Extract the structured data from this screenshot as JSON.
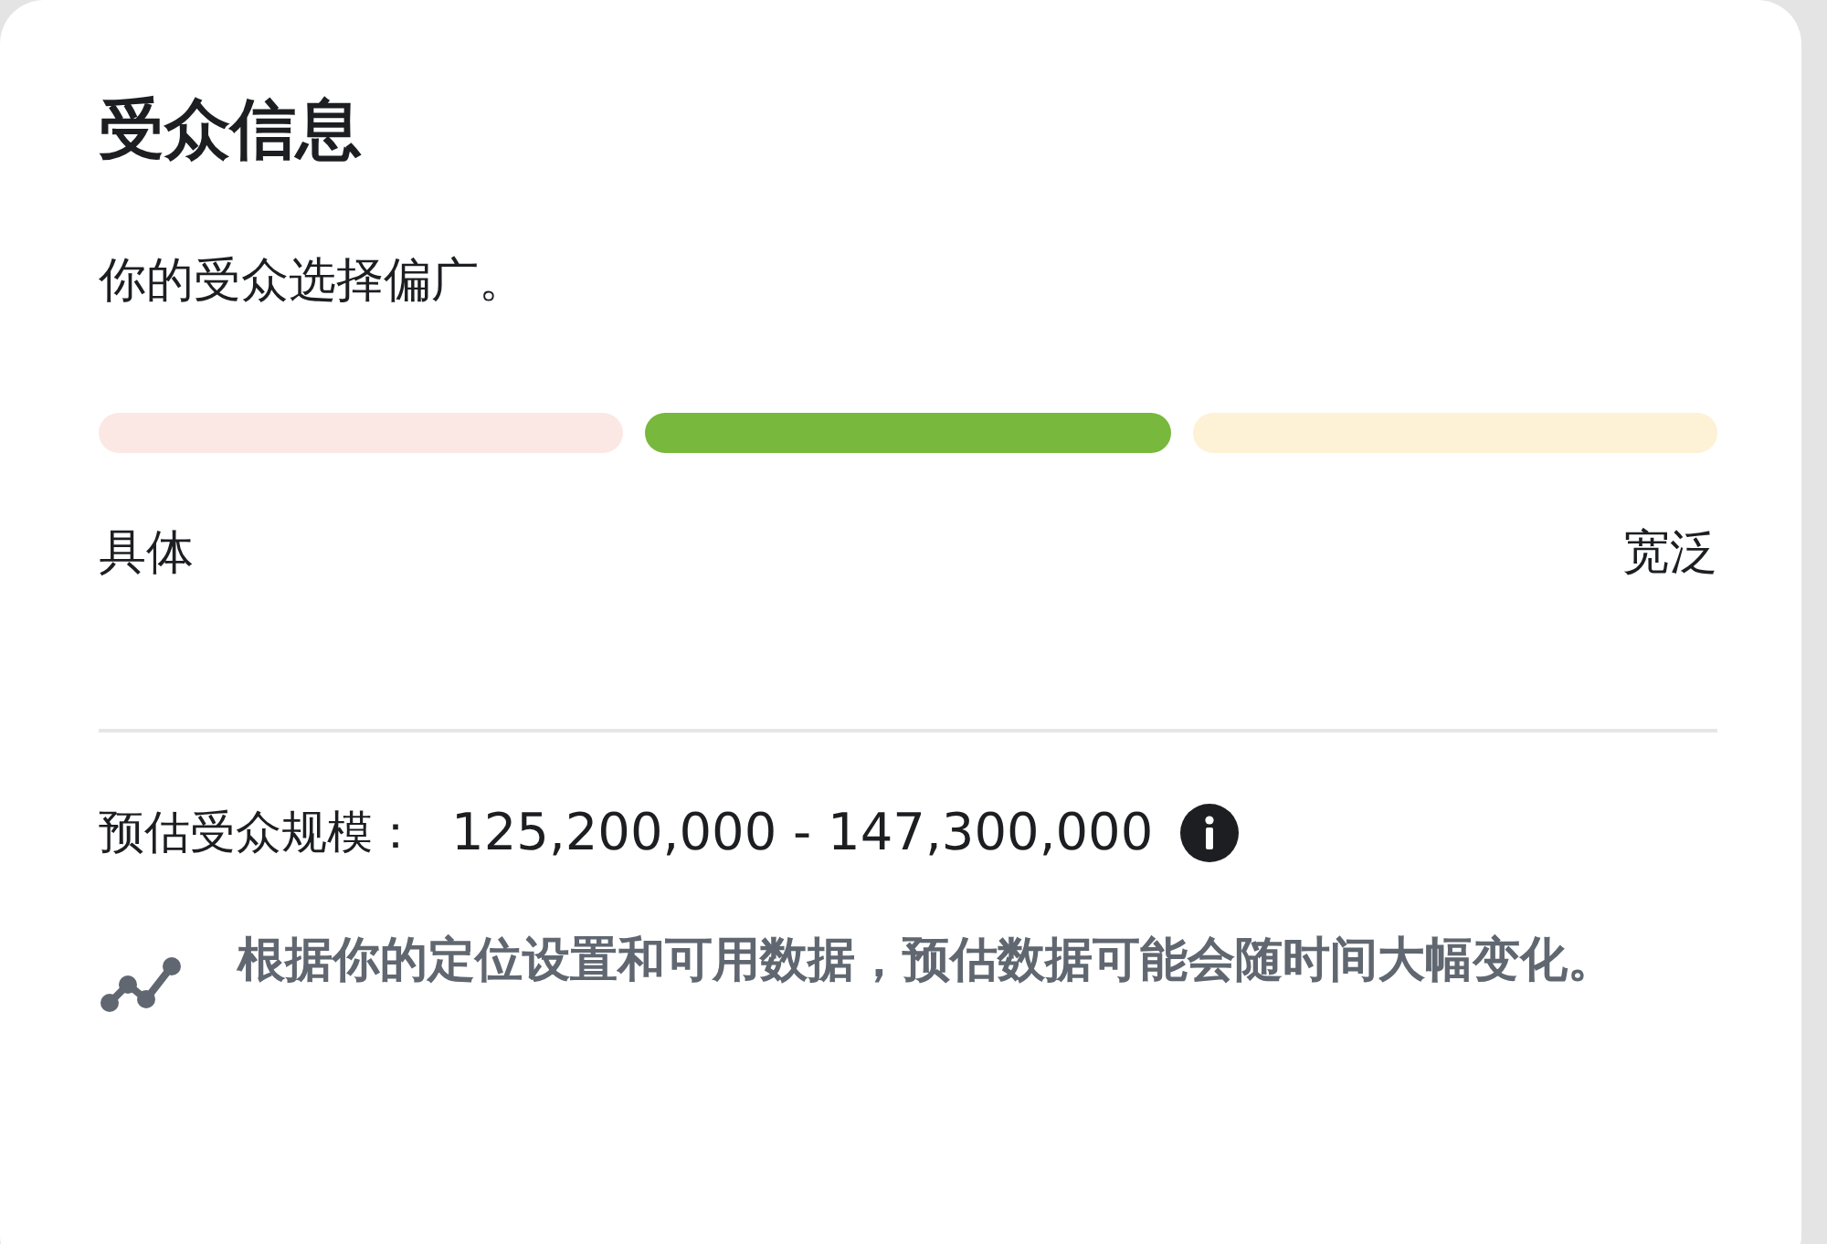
{
  "title": "受众信息",
  "summary": "你的受众选择偏广。",
  "meter": {
    "segments": [
      {
        "selected": false
      },
      {
        "selected": true
      },
      {
        "selected": false
      }
    ],
    "min_label": "具体",
    "max_label": "宽泛"
  },
  "estimate": {
    "label": "预估受众规模：",
    "value": "125,200,000 - 147,300,000"
  },
  "note": "根据你的定位设置和可用数据，预估数据可能会随时间大幅变化。"
}
